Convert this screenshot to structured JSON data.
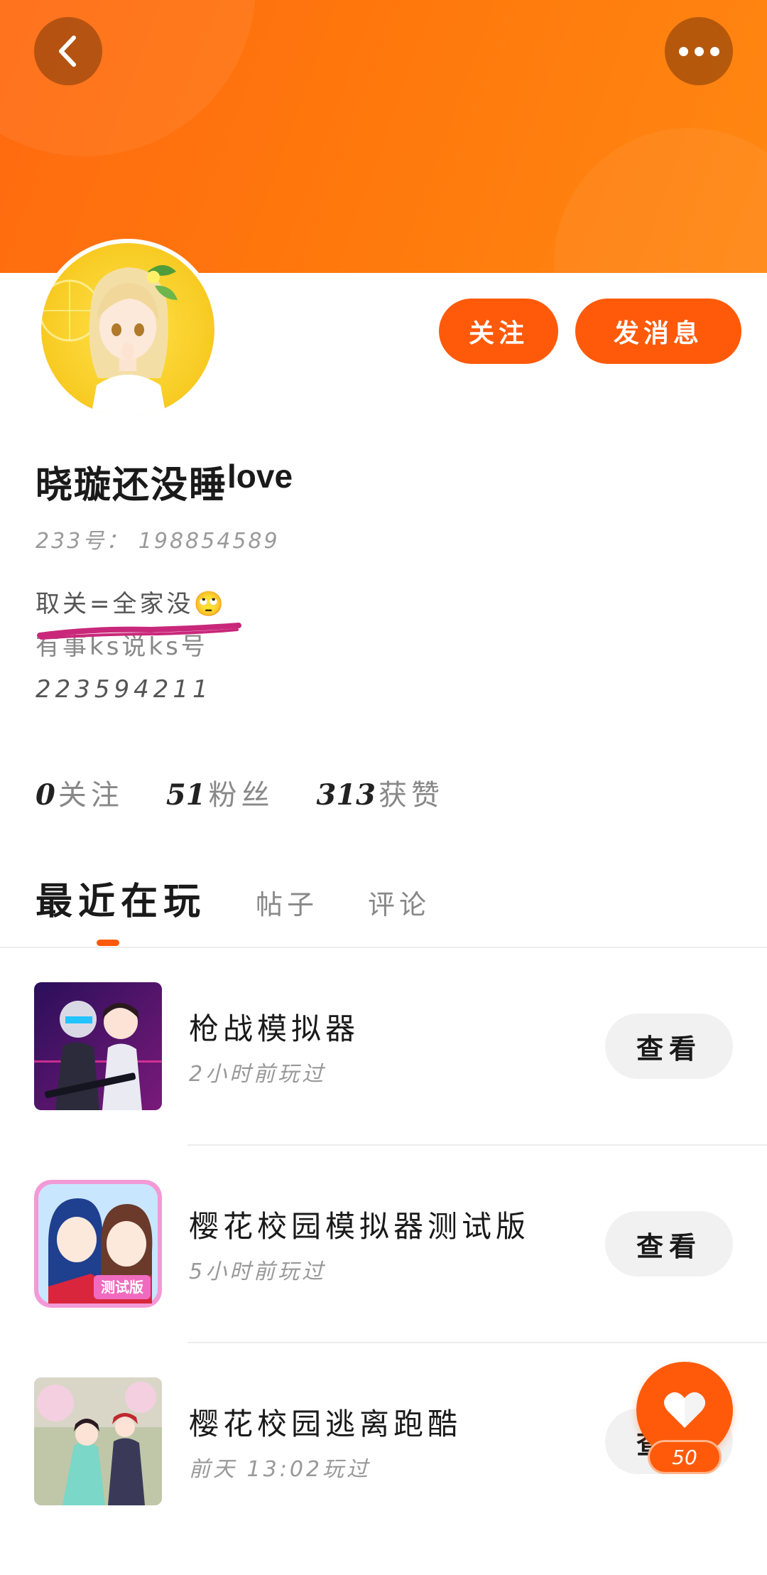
{
  "header": {
    "back_icon": "chevron-left-icon",
    "more_icon": "more-dots-icon",
    "banner_color": "#ff7a0c"
  },
  "profile": {
    "nickname": "晓璇还没睡",
    "nickname_suffix": "love",
    "account_id": "233号： 198854589",
    "bio_lines": [
      "取关=全家没🙄",
      "有事ks说ks号",
      "223594211"
    ],
    "follow_label": "关注",
    "message_label": "发消息",
    "accent_color": "#ff5a0a"
  },
  "stats": [
    {
      "value": "0",
      "label": "关注"
    },
    {
      "value": "51",
      "label": "粉丝"
    },
    {
      "value": "313",
      "label": "获赞"
    }
  ],
  "tabs": [
    {
      "label": "最近在玩",
      "active": true
    },
    {
      "label": "帖子",
      "active": false
    },
    {
      "label": "评论",
      "active": false
    }
  ],
  "games": [
    {
      "name": "枪战模拟器",
      "time": "2小时前玩过",
      "action": "查看"
    },
    {
      "name": "樱花校园模拟器测试版",
      "time": "5小时前玩过",
      "action": "查看"
    },
    {
      "name": "樱花校园逃离跑酷",
      "time": "前天 13:02玩过",
      "action": "查看"
    }
  ],
  "like_fab": {
    "icon": "heart-icon",
    "count": "50"
  }
}
